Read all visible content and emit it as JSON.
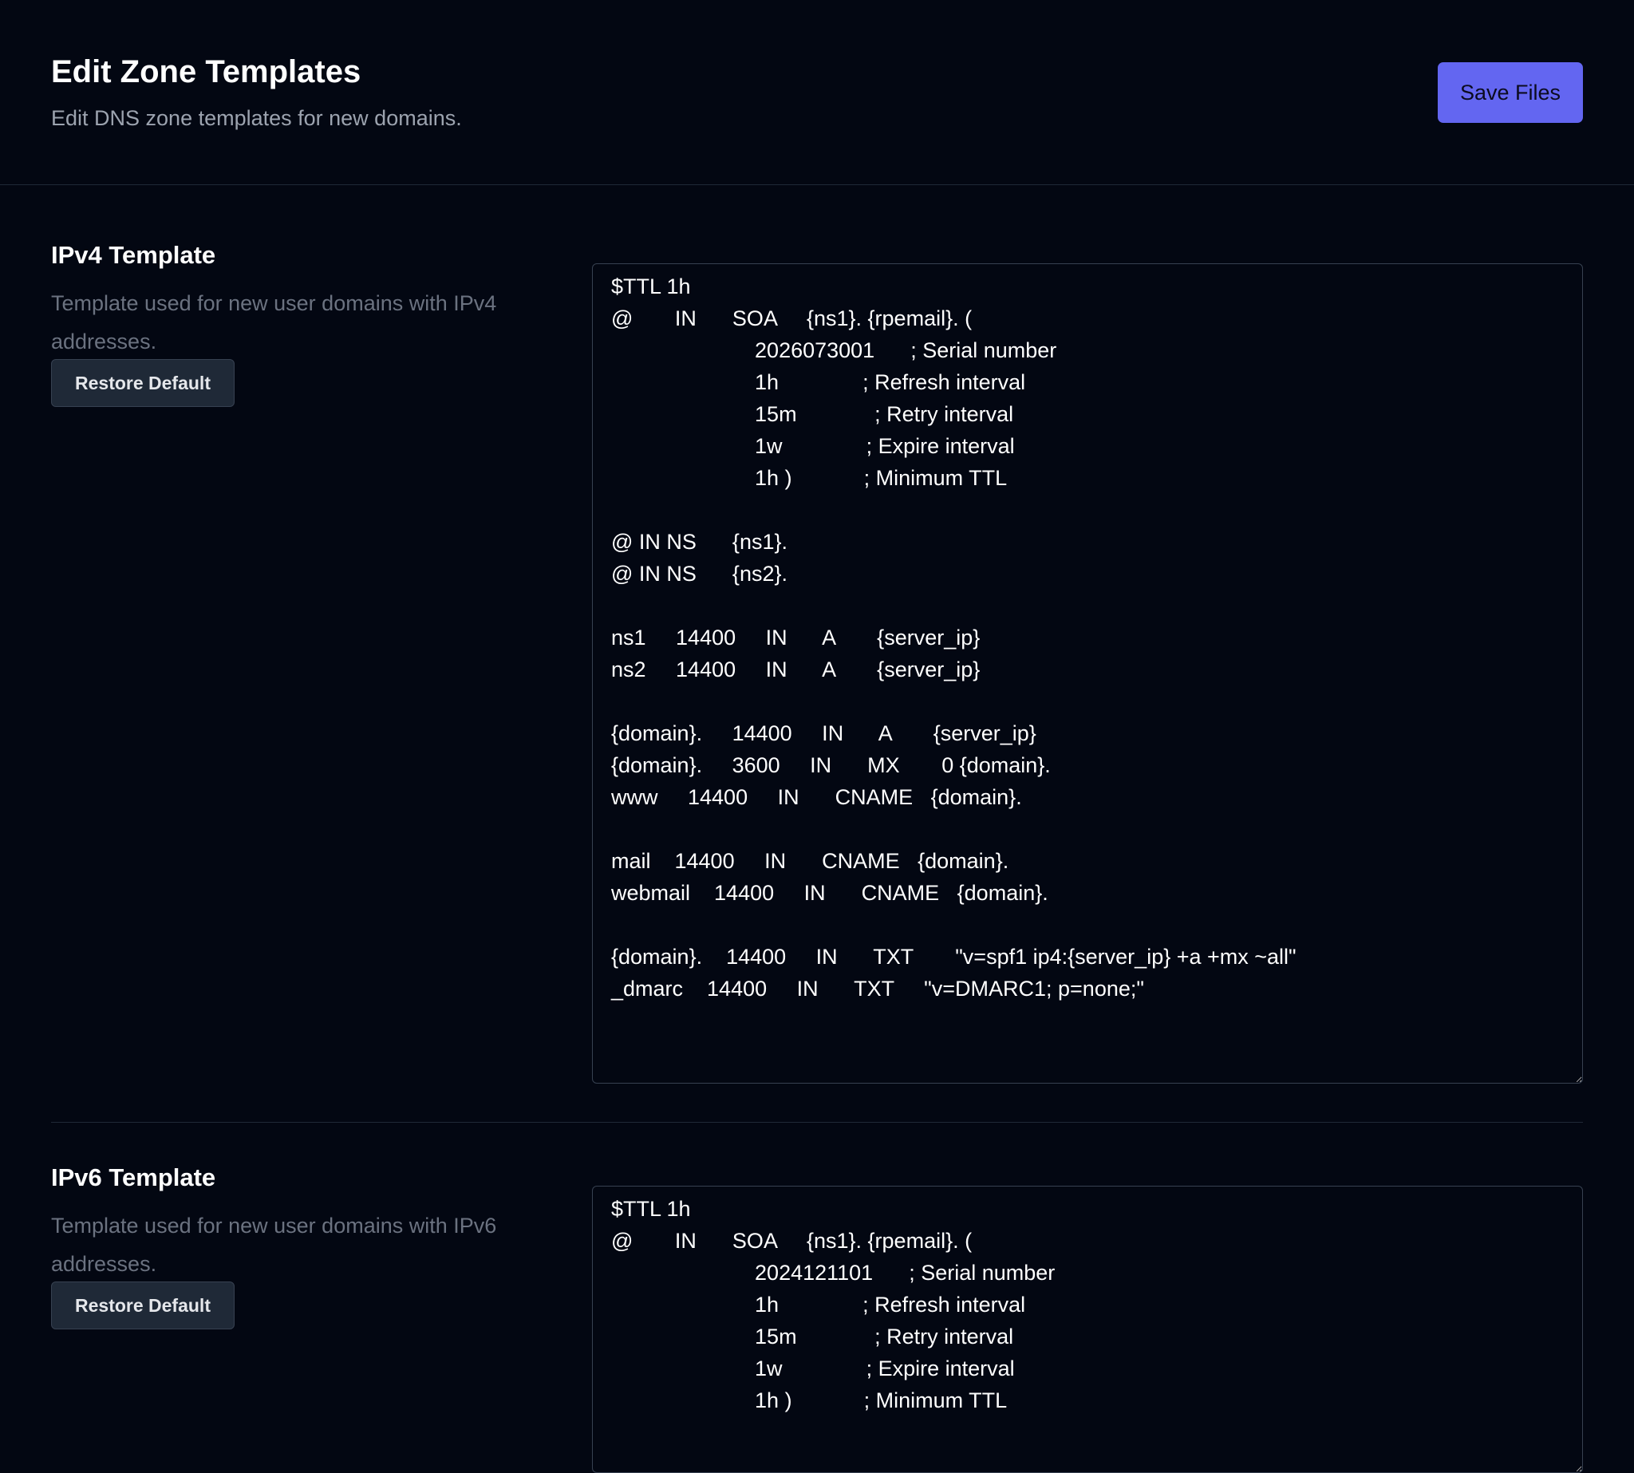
{
  "header": {
    "title": "Edit Zone Templates",
    "subtitle": "Edit DNS zone templates for new domains.",
    "save_label": "Save Files"
  },
  "colors": {
    "background": "#030712",
    "accent": "#6366f1",
    "secondary_button": "#1f2937",
    "muted_text": "#6b7280"
  },
  "templates": [
    {
      "title": "IPv4 Template",
      "description": "Template used for new user domains with IPv4 addresses.",
      "restore_label": "Restore Default",
      "content": "$TTL 1h\n@       IN      SOA     {ns1}. {rpemail}. (\n                        2026073001      ; Serial number\n                        1h              ; Refresh interval\n                        15m             ; Retry interval\n                        1w              ; Expire interval\n                        1h )            ; Minimum TTL\n\n@ IN NS      {ns1}.\n@ IN NS      {ns2}.\n\nns1     14400     IN      A       {server_ip}\nns2     14400     IN      A       {server_ip}\n\n{domain}.     14400     IN      A       {server_ip}\n{domain}.     3600     IN      MX       0 {domain}.\nwww     14400     IN      CNAME   {domain}.\n\nmail    14400     IN      CNAME   {domain}.\nwebmail    14400     IN      CNAME   {domain}.\n\n{domain}.    14400     IN      TXT       \"v=spf1 ip4:{server_ip} +a +mx ~all\"\n_dmarc    14400     IN      TXT     \"v=DMARC1; p=none;\""
    },
    {
      "title": "IPv6 Template",
      "description": "Template used for new user domains with IPv6 addresses.",
      "restore_label": "Restore Default",
      "content": "$TTL 1h\n@       IN      SOA     {ns1}. {rpemail}. (\n                        2024121101      ; Serial number\n                        1h              ; Refresh interval\n                        15m             ; Retry interval\n                        1w              ; Expire interval\n                        1h )            ; Minimum TTL"
    }
  ]
}
